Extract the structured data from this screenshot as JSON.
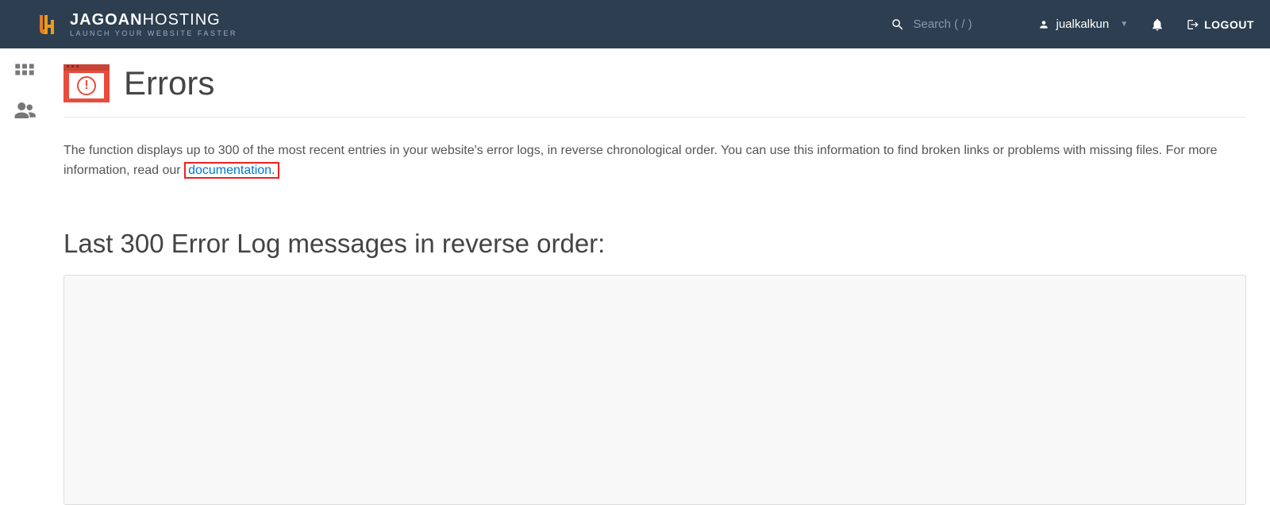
{
  "header": {
    "logo_main_bold": "JAGOAN",
    "logo_main_light": "HOSTING",
    "logo_tagline": "LAUNCH YOUR WEBSITE FASTER",
    "search_placeholder": "Search ( / )",
    "username": "jualkalkun",
    "logout_label": "LOGOUT"
  },
  "page": {
    "title": "Errors",
    "description_before": "The function displays up to 300 of the most recent entries in your website's error logs, in reverse chronological order. You can use this information to find broken links or problems with missing files. For more information, read our ",
    "doc_link_text": "documentation",
    "description_after": ".",
    "section_heading": "Last 300 Error Log messages in reverse order:"
  }
}
